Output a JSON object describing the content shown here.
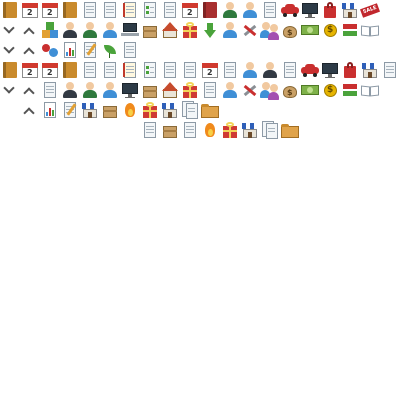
{
  "sheet": {
    "rows": [
      [
        "book-icon",
        "calendar-icon",
        "calendar-icon",
        "book-icon",
        "document-icon",
        "document-icon",
        "notebook-icon",
        "checklist-icon",
        "document-icon",
        "calendar-icon",
        "book-icon",
        "person-icon",
        "person-icon",
        "document-icon",
        "car-icon",
        "monitor-icon",
        "shopping-bag-icon",
        "storefront-icon",
        "sale-tag-icon"
      ],
      [
        "chevron-down-icon",
        "chevron-up-icon",
        "blocks-icon",
        "person-icon",
        "person-icon",
        "person-icon",
        "laptop-icon",
        "boxes-icon",
        "house-icon",
        "gift-icon",
        "download-arrow-icon",
        "person-icon",
        "tools-icon",
        "people-icon",
        "coin-bag-icon",
        "cash-icon",
        "coin-icon",
        "arrows-icon",
        "open-book-icon"
      ],
      [
        "chevron-down-icon",
        "chevron-up-icon",
        "puzzle-icon",
        "chart-icon",
        "pencil-icon",
        "leaf-icon",
        "document-icon"
      ],
      [
        "book-icon",
        "calendar-icon",
        "calendar-icon",
        "book-icon",
        "document-icon",
        "document-icon",
        "notebook-icon",
        "checklist-icon",
        "document-icon",
        "document-icon",
        "calendar-icon",
        "document-icon",
        "person-icon",
        "person-icon",
        "document-icon",
        "car-icon",
        "monitor-icon",
        "shopping-bag-icon",
        "storefront-icon",
        "document-icon"
      ],
      [
        "chevron-down-icon",
        "chevron-up-icon",
        "document-icon",
        "person-icon",
        "person-icon",
        "person-icon",
        "monitor-icon",
        "boxes-icon",
        "house-icon",
        "gift-icon",
        "document-icon",
        "person-icon",
        "tools-icon",
        "people-icon",
        "coin-bag-icon",
        "cash-icon",
        "coin-icon",
        "arrows-icon",
        "open-book-icon"
      ],
      [
        "chevron-up-icon",
        "chart-icon",
        "pencil-icon",
        "storefront-icon",
        "boxes-icon",
        "flame-icon",
        "gift-icon",
        "storefront-icon",
        "files-icon",
        "folder-icon"
      ],
      [
        "document-icon",
        "boxes-icon",
        "document-icon",
        "flame-icon",
        "gift-icon",
        "storefront-icon",
        "files-icon",
        "folder-icon"
      ]
    ],
    "labels": {
      "calendar_day": "2",
      "coin_symbol": "$",
      "sale_text": "SALE"
    },
    "colors": {
      "background": "#ffffff",
      "accent_red": "#d03a2f",
      "accent_blue": "#2f5fb8"
    }
  }
}
